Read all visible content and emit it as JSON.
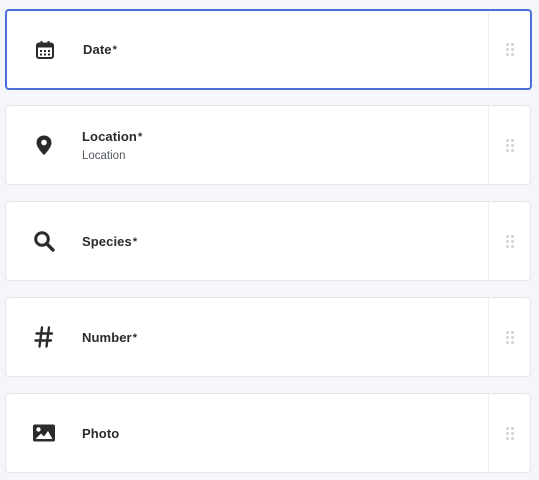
{
  "fields": [
    {
      "label": "Date",
      "required_mark": "*",
      "sublabel": "",
      "icon": "calendar-icon",
      "selected": true
    },
    {
      "label": "Location",
      "required_mark": "*",
      "sublabel": "Location",
      "icon": "map-pin-icon",
      "selected": false
    },
    {
      "label": "Species",
      "required_mark": "*",
      "sublabel": "",
      "icon": "search-icon",
      "selected": false
    },
    {
      "label": "Number",
      "required_mark": "*",
      "sublabel": "",
      "icon": "hash-icon",
      "selected": false
    },
    {
      "label": "Photo",
      "required_mark": "",
      "sublabel": "",
      "icon": "image-icon",
      "selected": false
    }
  ],
  "colors": {
    "selected_border": "#4a6fd8",
    "card_border": "#e3e6ea",
    "background": "#f4f6f9",
    "icon": "#2b2b2b"
  }
}
